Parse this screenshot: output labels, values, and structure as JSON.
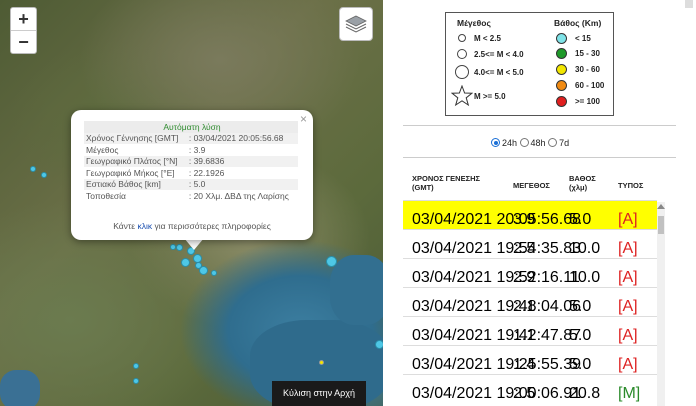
{
  "map": {
    "zoom_in": "+",
    "zoom_out": "−",
    "popup": {
      "title": "Αυτόματη λύση",
      "rows": [
        {
          "label": "Χρόνος Γέννησης [GMT]",
          "value": ": 03/04/2021 20:05:56.68"
        },
        {
          "label": "Μέγεθος",
          "value": ": 3.9"
        },
        {
          "label": "Γεωγραφικό Πλάτος [°N]",
          "value": ": 39.6836"
        },
        {
          "label": "Γεωγραφικό Μήκος [°E]",
          "value": ": 22.1926"
        },
        {
          "label": "Εστιακό Βάθος [km]",
          "value": ": 5.0"
        },
        {
          "label": "Τοποθεσία",
          "value": ": 20 Χλμ. ΔΒΔ της Λαρίσης"
        }
      ],
      "more_pre": "Κάντε ",
      "more_link": "κλικ",
      "more_post": " για περισσότερες πληροφορίες",
      "close": "×"
    },
    "scroll_top": "Κύλιση στην Αρχή",
    "colors": {
      "quake_fill": "#4ec7e6"
    }
  },
  "legend": {
    "magnitude_title": "Μέγεθος",
    "depth_title": "Βάθος (Km)",
    "magnitudes": [
      "M < 2.5",
      "2.5<= M < 4.0",
      "4.0<= M < 5.0",
      "M >= 5.0"
    ],
    "depths": [
      {
        "label": "< 15",
        "color": "#7fe3e8"
      },
      {
        "label": "15 - 30",
        "color": "#1f9a2a"
      },
      {
        "label": "30 - 60",
        "color": "#f2e600"
      },
      {
        "label": "60 - 100",
        "color": "#f08a12"
      },
      {
        "label": ">= 100",
        "color": "#e01f1f"
      }
    ]
  },
  "period": {
    "options": [
      "24h",
      "48h",
      "7d"
    ],
    "selected": "24h"
  },
  "table": {
    "headers": {
      "time": "ΧΡΟΝΟΣ ΓΕΝΕΣΗΣ (GMT)",
      "magnitude": "ΜΕΓΕΘΟΣ",
      "depth": "ΒΑΘΟΣ (χλμ)",
      "type": "ΤΥΠΟΣ"
    },
    "rows": [
      {
        "time": "03/04/2021 20:05:56.68",
        "magnitude": "3.9",
        "depth": "5.0",
        "type": "[A]"
      },
      {
        "time": "03/04/2021 19:54:35.83",
        "magnitude": "2.5",
        "depth": "10.0",
        "type": "[A]"
      },
      {
        "time": "03/04/2021 19:52:16.11",
        "magnitude": "2.9",
        "depth": "10.0",
        "type": "[A]"
      },
      {
        "time": "03/04/2021 19:48:04.06",
        "magnitude": "2.1",
        "depth": "5.0",
        "type": "[A]"
      },
      {
        "time": "03/04/2021 19:42:47.87",
        "magnitude": "1.1",
        "depth": "5.0",
        "type": "[A]"
      },
      {
        "time": "03/04/2021 19:25:55.39",
        "magnitude": "1.4",
        "depth": "5.0",
        "type": "[A]"
      },
      {
        "time": "03/04/2021 19:00:06.91",
        "magnitude": "2.5",
        "depth": "20.8",
        "type": "[M]"
      }
    ],
    "highlight_color": "#ffff00"
  }
}
